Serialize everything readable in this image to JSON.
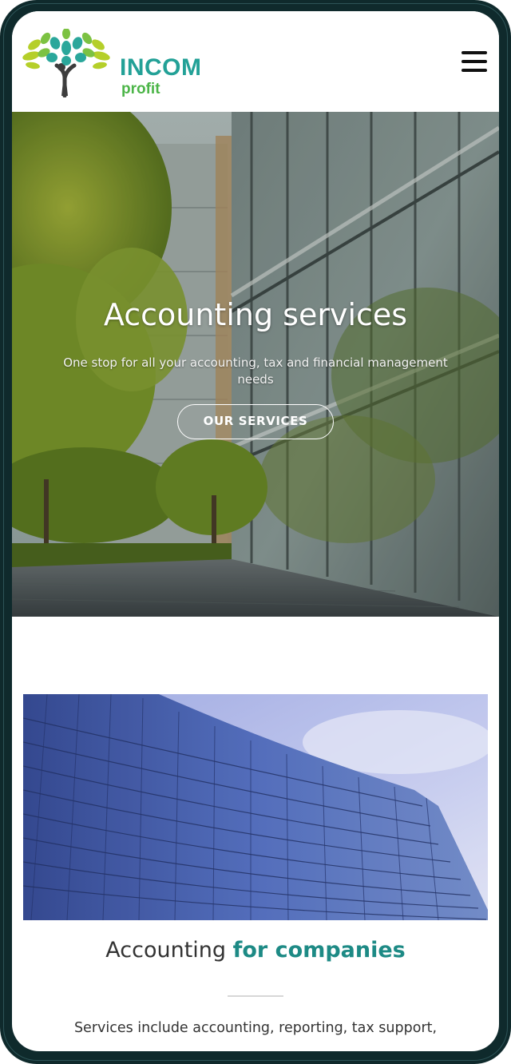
{
  "header": {
    "brand_name": "INCOM",
    "brand_sub": "profit",
    "menu_icon": "hamburger-menu-icon"
  },
  "hero": {
    "title": "Accounting services",
    "subtitle": "One stop for all your accounting, tax and financial management needs",
    "button_label": "OUR SERVICES"
  },
  "companies": {
    "title_prefix": "Accounting ",
    "title_accent": "for companies",
    "text": "Services include accounting, reporting, tax support,"
  },
  "colors": {
    "brand_teal": "#23a197",
    "brand_green": "#4cb548",
    "accent_teal": "#1d8a85",
    "device_frame": "#0f2a2c"
  }
}
